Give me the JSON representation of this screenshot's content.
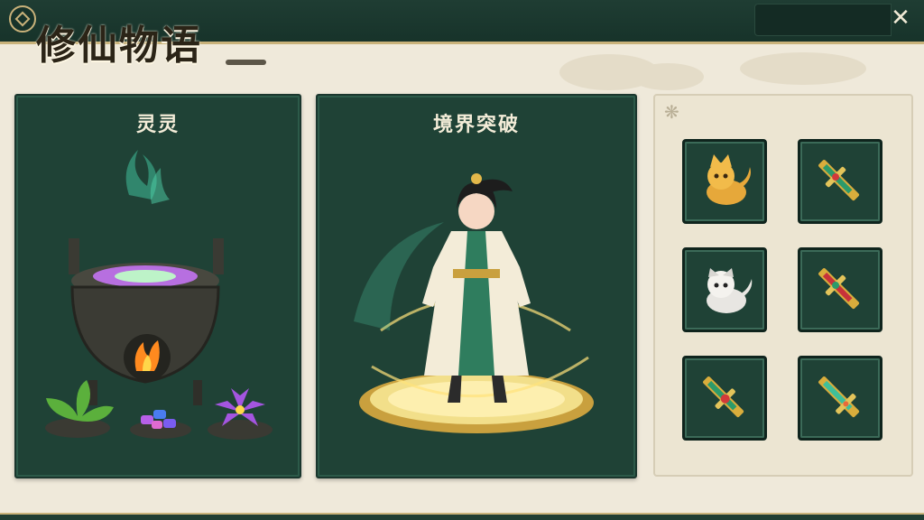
{
  "header": {
    "title": "修仙物语",
    "close_label": "✕"
  },
  "panels": {
    "alchemy": {
      "title": "灵灵"
    },
    "breakthrough": {
      "title": "境界突破"
    }
  },
  "inventory": {
    "header_icon": "snowflake-icon",
    "items": [
      {
        "name": "golden-fox-pet-icon"
      },
      {
        "name": "green-ruby-sword-icon"
      },
      {
        "name": "white-beast-pet-icon"
      },
      {
        "name": "red-ruby-sword-icon"
      },
      {
        "name": "ruby-gem-sword-icon"
      },
      {
        "name": "jade-sword-icon"
      }
    ]
  },
  "colors": {
    "panel": "#1f4236",
    "gold": "#c9b27a",
    "parchment": "#efe9da"
  }
}
